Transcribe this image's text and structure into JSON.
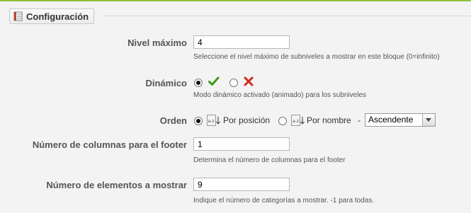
{
  "fieldset": {
    "title": "Configuración"
  },
  "fields": {
    "max_level": {
      "label": "Nivel máximo",
      "value": "4",
      "help": "Seleccione el nivel máximo de subniveles a mostrar en este bloque (0=infinito)"
    },
    "dynamic": {
      "label": "Dinámico",
      "selected": "yes",
      "help": "Modo dinámico activado (animado) para los subniveles"
    },
    "order": {
      "label": "Orden",
      "option_position": "Por posición",
      "option_name": "Por nombre",
      "separator": "-",
      "direction": "Ascendente"
    },
    "footer_columns": {
      "label": "Número de columnas para el footer",
      "value": "1",
      "help": "Determina el número de columnas para el footer"
    },
    "num_elements": {
      "label": "Número de elementos a mostrar",
      "value": "9",
      "help": "Indique el número de categorías a mostrar. -1 para todas."
    }
  },
  "colors": {
    "accent_top": "#8fc13f",
    "check_green": "#3c9a1b",
    "cross_red": "#d3281c"
  },
  "icons": [
    "settings-icon",
    "check-icon",
    "cross-icon",
    "sort-position-icon",
    "sort-name-icon",
    "chevron-down-icon"
  ]
}
